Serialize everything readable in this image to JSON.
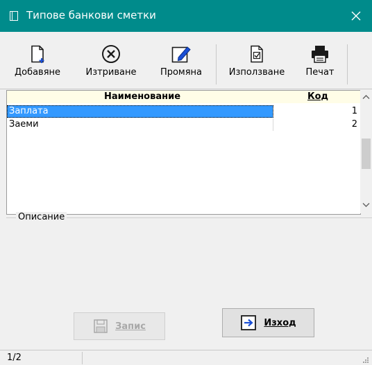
{
  "window": {
    "title": "Типове банкови сметки",
    "close_icon": "close-icon"
  },
  "toolbar": {
    "add_label": "Добавяне",
    "delete_label": "Изтриване",
    "edit_label": "Промяна",
    "use_label": "Използване",
    "print_label": "Печат"
  },
  "grid": {
    "columns": {
      "name": "Наименование",
      "code": "Код"
    },
    "rows": [
      {
        "name": "Заплата",
        "code": "1",
        "selected": true
      },
      {
        "name": "Заеми",
        "code": "2",
        "selected": false
      }
    ]
  },
  "description": {
    "label": "Описание",
    "value": ""
  },
  "buttons": {
    "save_label": "Запис",
    "exit_label": "Изход"
  },
  "status": {
    "record_count": "1/2"
  },
  "colors": {
    "titlebar": "#008b8b",
    "selection": "#3399ff",
    "header_bg": "#fffde7"
  }
}
